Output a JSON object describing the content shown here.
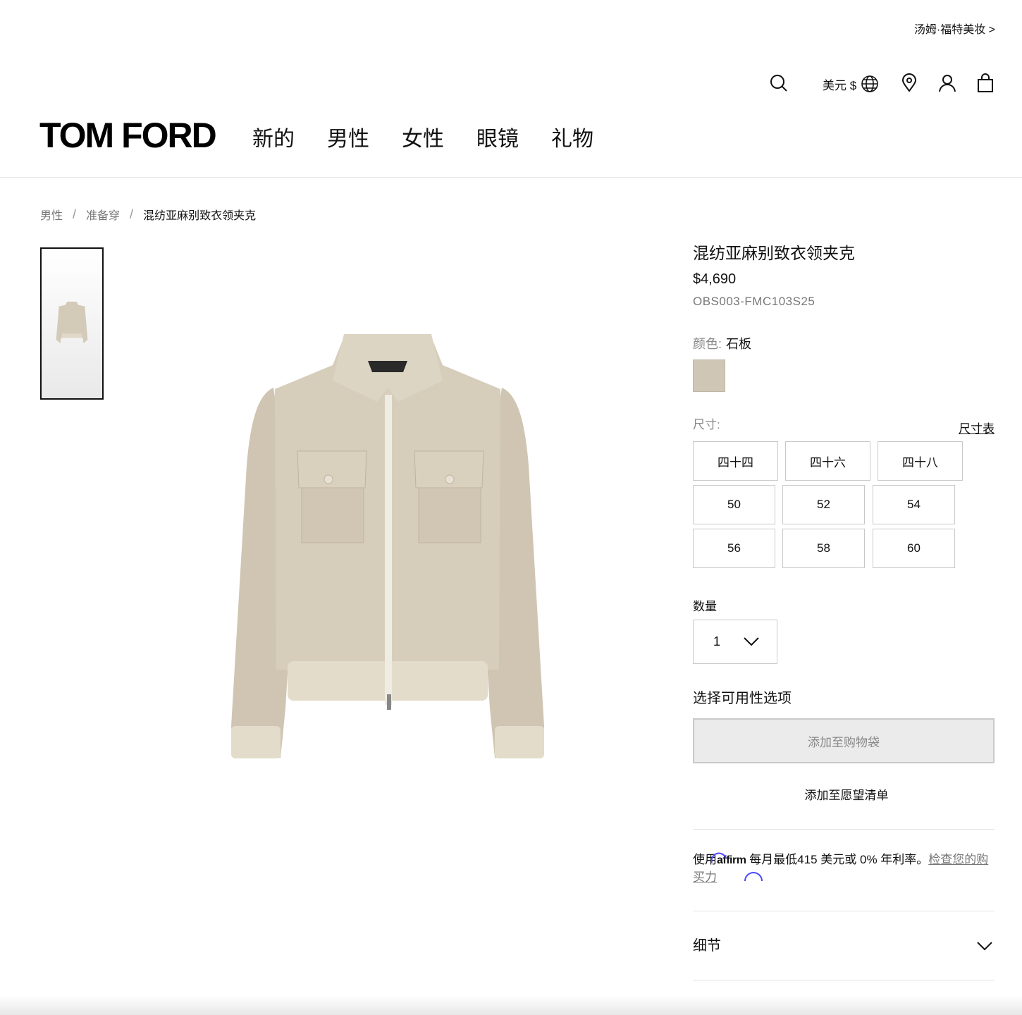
{
  "header": {
    "beauty_link": "汤姆·福特美妆 >",
    "currency_label": "美元 $",
    "logo": "TOM FORD",
    "nav": [
      "新的",
      "男性",
      "女性",
      "眼镜",
      "礼物"
    ]
  },
  "breadcrumb": {
    "items": [
      "男性",
      "准备穿"
    ],
    "current": "混纺亚麻别致衣领夹克"
  },
  "product": {
    "title": "混纺亚麻别致衣领夹克",
    "price": "$4,690",
    "sku": "OBS003-FMC103S25",
    "color_label": "颜色:",
    "color_value": "石板",
    "swatch_color": "#cfc6b5",
    "size_label": "尺寸:",
    "size_chart_link": "尺寸表",
    "sizes": [
      "四十四",
      "四十六",
      "四十八",
      "50",
      "52",
      "54",
      "56",
      "58",
      "60"
    ],
    "quantity_label": "数量",
    "quantity_value": "1",
    "availability_label": "选择可用性选项",
    "add_to_bag": "添加至购物袋",
    "add_to_wishlist": "添加至愿望清单"
  },
  "affirm": {
    "prefix": "使用",
    "brand": "affirm",
    "text": " 每月最低415 美元或 0% 年利率。",
    "link": "检查您的购买力"
  },
  "details": {
    "label": "细节"
  },
  "colors": {
    "text": "#111111",
    "muted": "#777777",
    "border": "#c9c9c9",
    "disabled_bg": "#ebebeb",
    "affirm_spinner": "#4a4aff"
  }
}
